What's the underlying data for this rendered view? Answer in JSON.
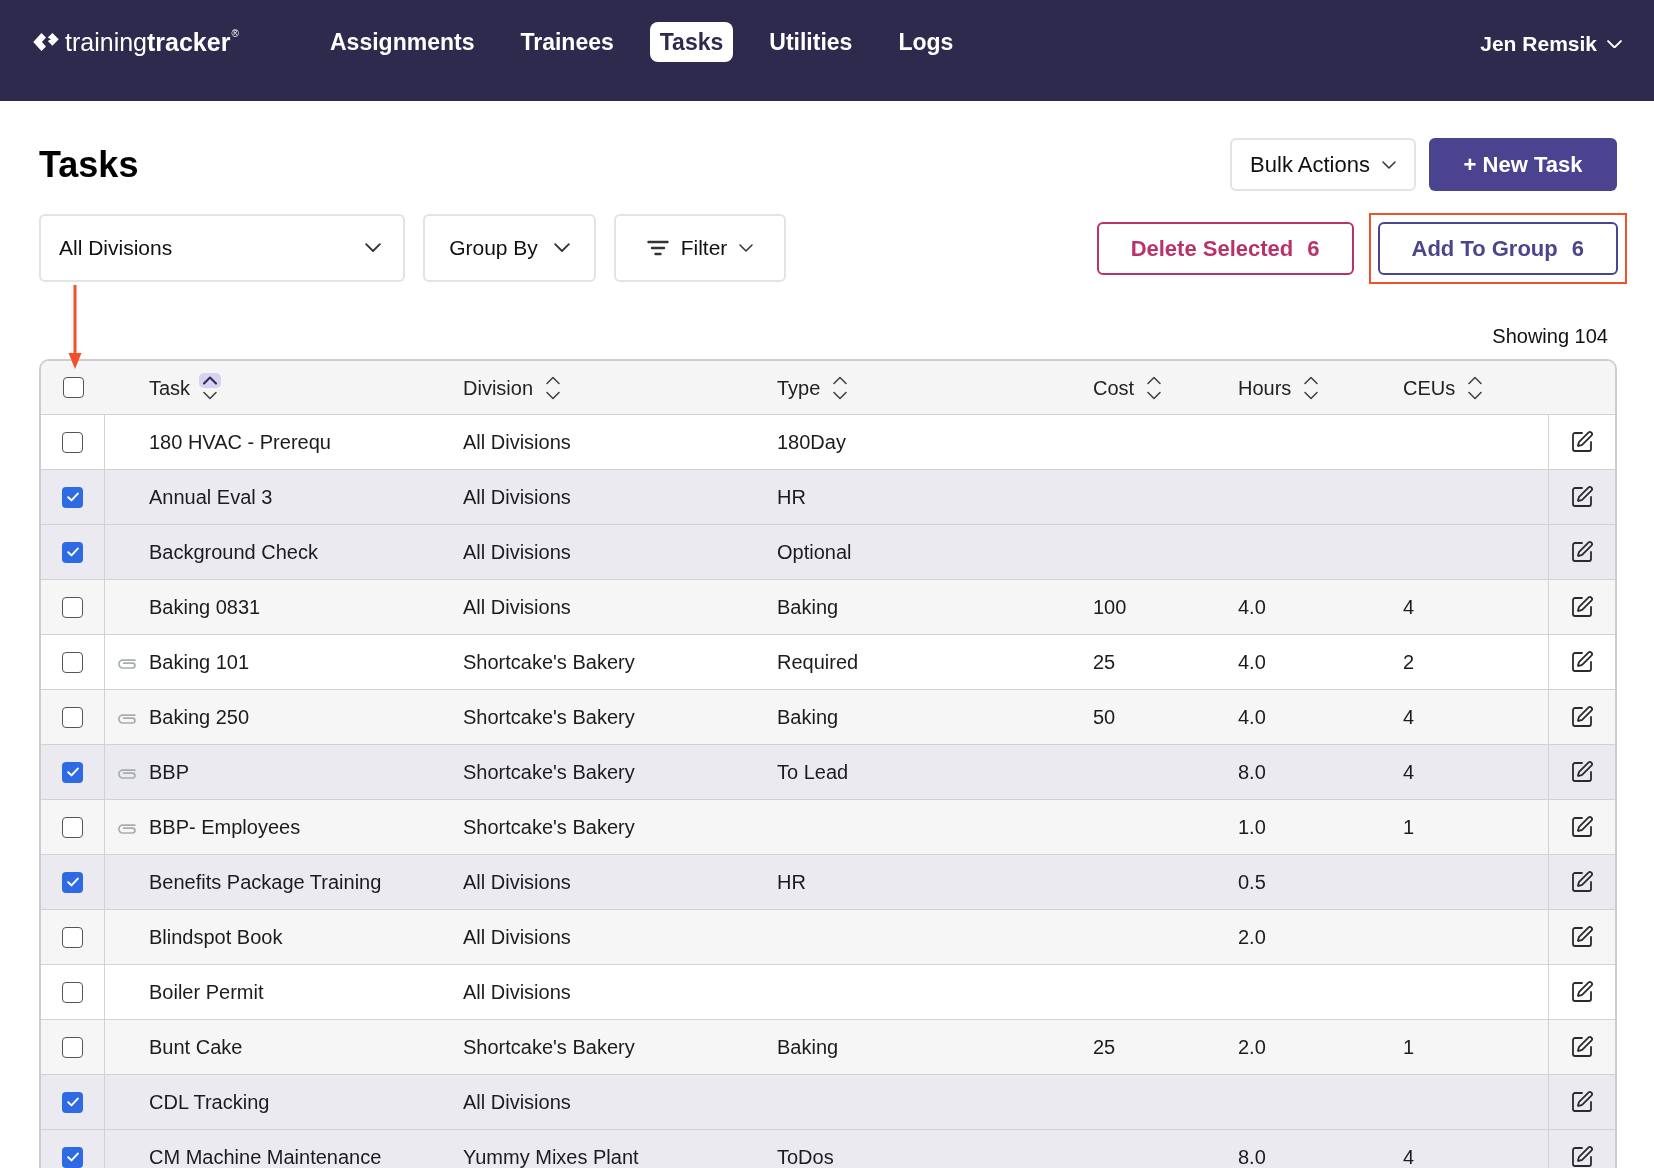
{
  "header": {
    "logo": "training**tracker**$^{®}$",
    "nav": [
      {
        "label": "Assignments",
        "selected": false
      },
      {
        "label": "Trainees",
        "selected": false
      },
      {
        "label": "Tasks",
        "selected": true
      },
      {
        "label": "Utilities",
        "selected": false
      },
      {
        "label": "Logs",
        "selected": false
      }
    ],
    "user": "Jen Remsik"
  },
  "page": {
    "title": "Tasks",
    "bulk_actions": "Bulk Actions",
    "new_task": "+ New Task"
  },
  "filters": {
    "division": "All Divisions",
    "group_by": "Group By",
    "filter": "Filter"
  },
  "actions": [
    {
      "kind": "delete",
      "label": "Delete Selected",
      "count": "6",
      "highlighted": false
    },
    {
      "kind": "add",
      "label": "Add To Group",
      "count": "6",
      "highlighted": true
    }
  ],
  "showing": "Showing 104",
  "table": {
    "select_all": {
      "checked": false
    },
    "columns": [
      {
        "label": "Task",
        "sorted_ascending": true
      },
      {
        "label": "Division",
        "sorted_ascending": false
      },
      {
        "label": "Type",
        "sorted_ascending": false
      },
      {
        "label": "Cost",
        "sorted_ascending": false
      },
      {
        "label": "Hours",
        "sorted_ascending": false
      },
      {
        "label": "CEUs",
        "sorted_ascending": false
      }
    ],
    "rows": [
      {
        "checked": false,
        "linked": false,
        "task": "180 HVAC - Prerequ",
        "division": "All Divisions",
        "type": "180Day"
      },
      {
        "checked": true,
        "linked": false,
        "task": "Annual Eval 3",
        "division": "All Divisions",
        "type": "HR"
      },
      {
        "checked": true,
        "linked": false,
        "task": "Background Check",
        "division": "All Divisions",
        "type": "Optional"
      },
      {
        "checked": false,
        "linked": false,
        "task": "Baking 0831",
        "division": "All Divisions",
        "type": "Baking",
        "cost": "100",
        "hours": "4.0",
        "ceus": "4"
      },
      {
        "checked": false,
        "linked": true,
        "task": "Baking 101",
        "division": "Shortcake's Bakery",
        "type": "Required",
        "cost": "25",
        "hours": "4.0",
        "ceus": "2"
      },
      {
        "checked": false,
        "linked": true,
        "task": "Baking 250",
        "division": "Shortcake's Bakery",
        "type": "Baking",
        "cost": "50",
        "hours": "4.0",
        "ceus": "4"
      },
      {
        "checked": true,
        "linked": true,
        "task": "BBP",
        "division": "Shortcake's Bakery",
        "type": "To Lead",
        "hours": "8.0",
        "ceus": "4"
      },
      {
        "checked": false,
        "linked": true,
        "task": "BBP- Employees",
        "division": "Shortcake's Bakery",
        "hours": "1.0",
        "ceus": "1"
      },
      {
        "checked": true,
        "linked": false,
        "task": "Benefits Package Training",
        "division": "All Divisions",
        "type": "HR",
        "hours": "0.5"
      },
      {
        "checked": false,
        "linked": false,
        "task": "Blindspot Book",
        "division": "All Divisions",
        "hours": "2.0"
      },
      {
        "checked": false,
        "linked": false,
        "task": "Boiler Permit",
        "division": "All Divisions"
      },
      {
        "checked": false,
        "linked": false,
        "task": "Bunt Cake",
        "division": "Shortcake's Bakery",
        "type": "Baking",
        "cost": "25",
        "hours": "2.0",
        "ceus": "1"
      },
      {
        "checked": true,
        "linked": false,
        "task": "CDL Tracking",
        "division": "All Divisions"
      },
      {
        "checked": true,
        "linked": false,
        "task": "CM Machine Maintenance",
        "division": "Yummy Mixes Plant",
        "type": "ToDos",
        "hours": "8.0",
        "ceus": "4"
      }
    ]
  }
}
